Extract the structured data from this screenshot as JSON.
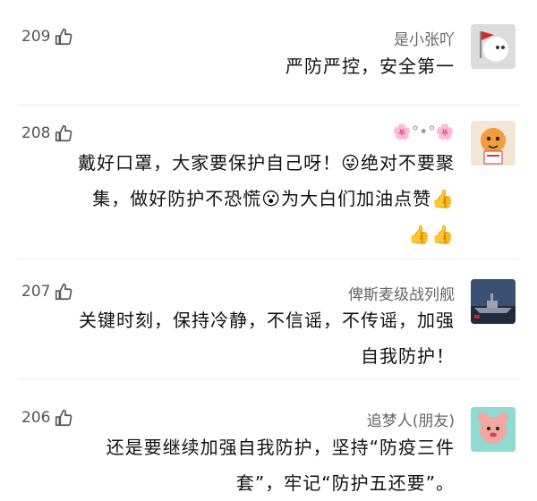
{
  "comments": [
    {
      "nickname": "是小张吖",
      "likes": "209",
      "text_lines": [
        "严防严控，安全第一"
      ],
      "avatar_icon": "red-flag-avatar"
    },
    {
      "nickname": "🌸°•°🌸",
      "likes": "208",
      "text_lines": [
        "戴好口罩，大家要保护自己呀！😜绝对不要聚",
        "集，做好防护不恐慌😮为大白们加油点赞👍",
        "👍👍"
      ],
      "avatar_icon": "tiger-cartoon-avatar"
    },
    {
      "nickname": "俾斯麦级战列舰",
      "likes": "207",
      "text_lines": [
        "关键时刻，保持冷静，不信谣，不传谣，加强",
        "自我防护！"
      ],
      "avatar_icon": "battleship-avatar"
    },
    {
      "nickname": "追梦人(朋友)",
      "likes": "206",
      "text_lines": [
        "还是要继续加强自我防护，坚持“防疫三件",
        "套”，牢记“防护五还要”。"
      ],
      "avatar_icon": "cartoon-character-avatar"
    }
  ],
  "colors": {
    "thumb_outline": "#555555",
    "emoji_yellow": "#f7c02b",
    "thumb_yellow": "#f5b800"
  }
}
